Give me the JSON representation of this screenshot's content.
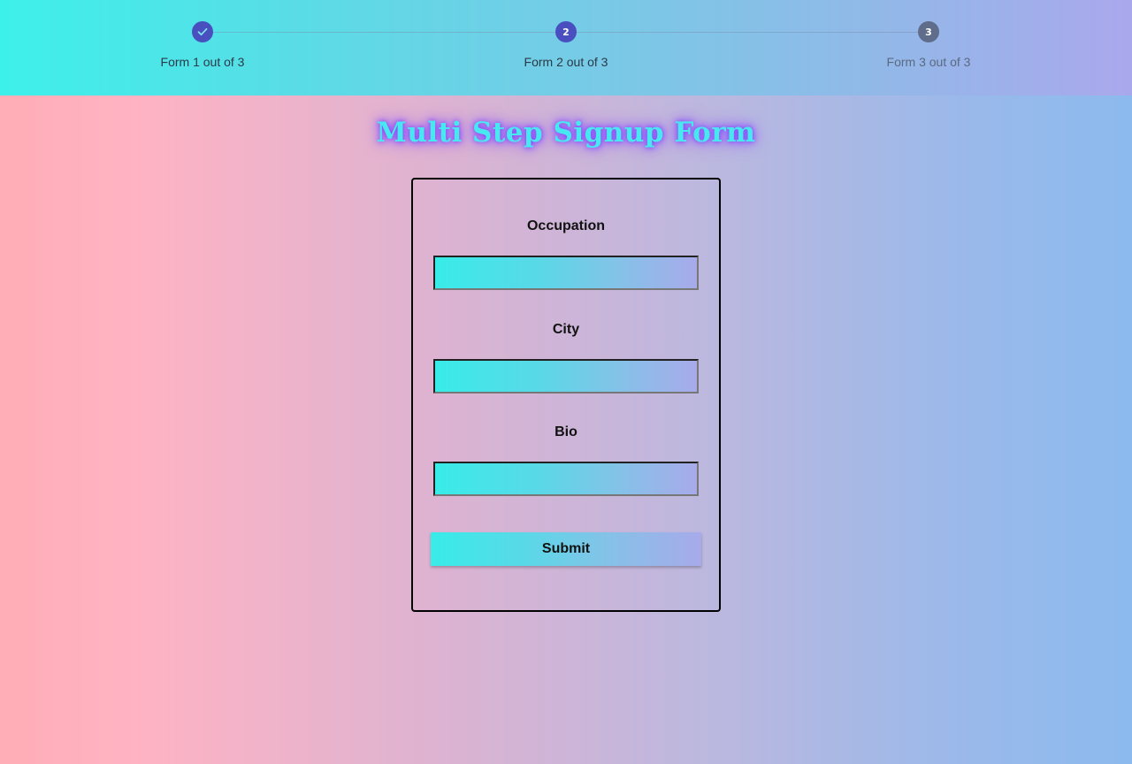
{
  "stepper": {
    "steps": [
      {
        "label": "Form 1 out of 3",
        "marker": "",
        "status": "done",
        "icon": "check-icon"
      },
      {
        "label": "Form 2 out of 3",
        "marker": "2",
        "status": "active"
      },
      {
        "label": "Form 3 out of 3",
        "marker": "3",
        "status": "pending"
      }
    ]
  },
  "title": "Multi Step Signup Form",
  "form": {
    "fields": [
      {
        "label": "Occupation",
        "value": ""
      },
      {
        "label": "City",
        "value": ""
      },
      {
        "label": "Bio",
        "value": ""
      }
    ],
    "submit_label": "Submit"
  },
  "colors": {
    "step_active": "#4a4fc0",
    "step_pending": "#5f6d8a",
    "title_text": "#48e8f0",
    "title_glow": "#8b4dff"
  }
}
